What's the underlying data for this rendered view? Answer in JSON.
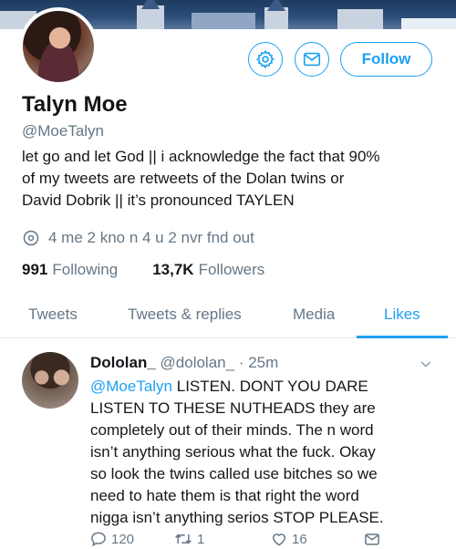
{
  "profile": {
    "name": "Talyn Moe",
    "handle": "@MoeTalyn",
    "bio_lines": [
      "let go and let God || i acknowledge the fact that 90%",
      "of my tweets are retweets of the Dolan twins or",
      "David Dobrik || it’s pronounced TAYLEN"
    ],
    "location": "4 me 2 kno n 4 u 2 nvr fnd out",
    "following_count": "991",
    "following_label": "Following",
    "followers_count": "13,7K",
    "followers_label": "Followers",
    "follow_label": "Follow"
  },
  "tabs": [
    {
      "label": "Tweets"
    },
    {
      "label": "Tweets & replies"
    },
    {
      "label": "Media"
    },
    {
      "label": "Likes"
    }
  ],
  "tweet": {
    "name": "Dololan_",
    "handle": "@dololan_",
    "time": "· 25m",
    "mention": "@MoeTalyn",
    "lines": [
      " LISTEN. DONT YOU DARE",
      "LISTEN TO THESE NUTHEADS they are",
      "completely out of their minds. The n word",
      "isn’t anything serious what the fuck. Okay",
      "so look the twins called use bitches so we",
      "need to hate them is that right the word",
      "nigga isn’t anything serios STOP PLEASE."
    ],
    "reply_count": "120",
    "retweet_count": "1",
    "like_count": "16"
  },
  "colors": {
    "accent": "#1da1f2",
    "muted": "#657786",
    "text": "#14171a"
  },
  "icons": {
    "settings": "gear-icon",
    "message": "envelope-icon",
    "location": "location-pin-icon",
    "more": "chevron-down-icon",
    "reply": "reply-icon",
    "retweet": "retweet-icon",
    "like": "heart-icon",
    "share": "share-icon"
  }
}
